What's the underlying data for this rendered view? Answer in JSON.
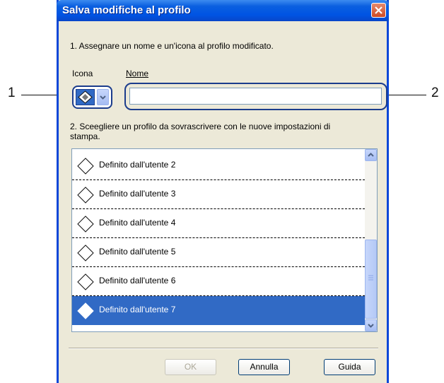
{
  "callouts": {
    "one": "1",
    "two": "2"
  },
  "dialog": {
    "title": "Salva modifiche al profilo",
    "step1": "1. Assegnare un nome e un'icona al profilo modificato.",
    "icon_label": "Icona",
    "name_label": "Nome",
    "name_value": "",
    "step2_line1": "2. Sceegliere un profilo da sovrascrivere con le nuove impostazioni di",
    "step2_line2": "stampa.",
    "profiles": [
      {
        "label": "Definito dall'utente 2"
      },
      {
        "label": "Definito dall'utente 3"
      },
      {
        "label": "Definito dall'utente 4"
      },
      {
        "label": "Definito dall'utente 5"
      },
      {
        "label": "Definito dall'utente 6"
      },
      {
        "label": "Definito dall'utente 7",
        "selected": true
      }
    ],
    "buttons": {
      "ok": "OK",
      "cancel": "Annulla",
      "help": "Guida"
    }
  }
}
